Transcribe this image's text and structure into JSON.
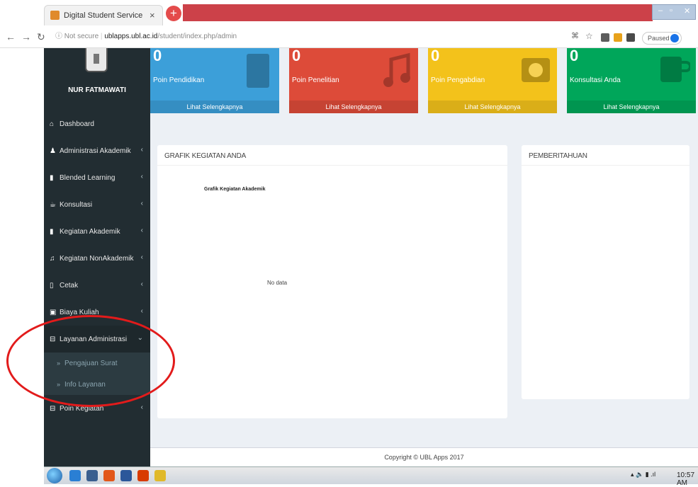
{
  "browser": {
    "tab_title": "Digital Student Service",
    "tab_close": "×",
    "new_tab": "+",
    "url_secure": "ⓘ Not secure",
    "url_host": "ublapps.ubl.ac.id",
    "url_path": "/student/index.php/admin",
    "paused_label": "Paused"
  },
  "sidebar": {
    "username": "NUR FATMAWATI",
    "items": [
      {
        "icon": "⌂",
        "label": "Dashboard",
        "chev": ""
      },
      {
        "icon": "♟",
        "label": "Administrasi Akademik",
        "chev": "‹"
      },
      {
        "icon": "▮",
        "label": "Blended Learning",
        "chev": "‹"
      },
      {
        "icon": "☕",
        "label": "Konsultasi",
        "chev": "‹"
      },
      {
        "icon": "▮",
        "label": "Kegiatan Akademik",
        "chev": "‹"
      },
      {
        "icon": "♫",
        "label": "Kegiatan NonAkademik",
        "chev": "‹"
      },
      {
        "icon": "▯",
        "label": "Cetak",
        "chev": "‹"
      },
      {
        "icon": "▣",
        "label": "Biaya Kuliah",
        "chev": "‹"
      },
      {
        "icon": "⊟",
        "label": "Layanan Administrasi",
        "chev": "⌄"
      }
    ],
    "subitems": [
      {
        "arrow": "»",
        "label": "Pengajuan Surat"
      },
      {
        "arrow": "»",
        "label": "Info Layanan"
      }
    ],
    "last_item": {
      "icon": "⊟",
      "label": "Poin Kegiatan",
      "chev": "‹"
    }
  },
  "boxes": [
    {
      "num": "0",
      "label": "Poin Pendidikan",
      "link": "Lihat Selengkapnya",
      "color": "#3c9fd9"
    },
    {
      "num": "0",
      "label": "Poin Penelitian",
      "link": "Lihat Selengkapnya",
      "color": "#dd4b39"
    },
    {
      "num": "0",
      "label": "Poin Pengabdian",
      "link": "Lihat Selengkapnya",
      "color": "#f3c21b"
    },
    {
      "num": "0",
      "label": "Konsultasi Anda",
      "link": "Lihat Selengkapnya",
      "color": "#00a65a"
    }
  ],
  "grafik": {
    "title": "GRAFIK KEGIATAN ANDA",
    "chart_title": "Grafik Kegiatan Akademik",
    "no_data": "No data"
  },
  "pemberitahuan": {
    "title": "PEMBERITAHUAN"
  },
  "footer": {
    "text": "Copyright © UBL Apps 2017"
  },
  "taskbar": {
    "clock": "10:57 AM"
  }
}
